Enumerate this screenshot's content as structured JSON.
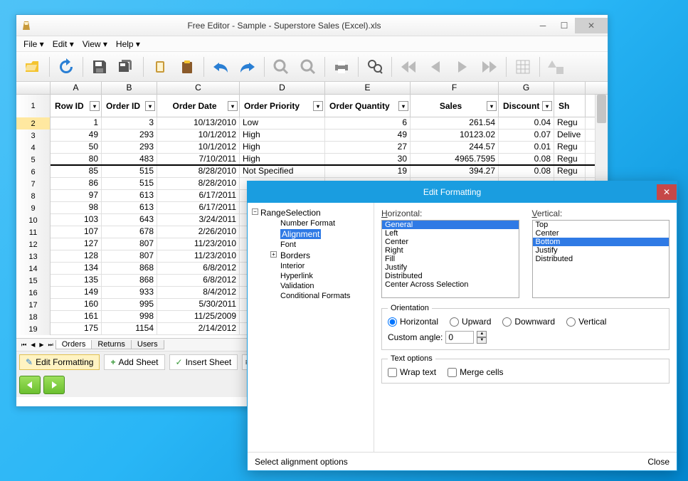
{
  "window": {
    "title": "Free Editor - Sample - Superstore Sales (Excel).xls"
  },
  "menu": {
    "file": "File",
    "edit": "Edit",
    "view": "View",
    "help": "Help"
  },
  "columns_letters": [
    "A",
    "B",
    "C",
    "D",
    "E",
    "F",
    "G"
  ],
  "headers": [
    "Row ID",
    "Order ID",
    "Order Date",
    "Order Priority",
    "Order Quantity",
    "Sales",
    "Discount",
    "Sh"
  ],
  "rows": [
    {
      "n": "2",
      "rid": "1",
      "oid": "3",
      "date": "10/13/2010",
      "prio": "Low",
      "qty": "6",
      "sales": "261.54",
      "disc": "0.04",
      "sh": "Regu"
    },
    {
      "n": "3",
      "rid": "49",
      "oid": "293",
      "date": "10/1/2012",
      "prio": "High",
      "qty": "49",
      "sales": "10123.02",
      "disc": "0.07",
      "sh": "Delive"
    },
    {
      "n": "4",
      "rid": "50",
      "oid": "293",
      "date": "10/1/2012",
      "prio": "High",
      "qty": "27",
      "sales": "244.57",
      "disc": "0.01",
      "sh": "Regu"
    },
    {
      "n": "5",
      "rid": "80",
      "oid": "483",
      "date": "7/10/2011",
      "prio": "High",
      "qty": "30",
      "sales": "4965.7595",
      "disc": "0.08",
      "sh": "Regu"
    },
    {
      "n": "6",
      "rid": "85",
      "oid": "515",
      "date": "8/28/2010",
      "prio": "Not Specified",
      "qty": "19",
      "sales": "394.27",
      "disc": "0.08",
      "sh": "Regu"
    },
    {
      "n": "7",
      "rid": "86",
      "oid": "515",
      "date": "8/28/2010",
      "prio": "",
      "qty": "",
      "sales": "",
      "disc": "",
      "sh": ""
    },
    {
      "n": "8",
      "rid": "97",
      "oid": "613",
      "date": "6/17/2011",
      "prio": "",
      "qty": "",
      "sales": "",
      "disc": "",
      "sh": ""
    },
    {
      "n": "9",
      "rid": "98",
      "oid": "613",
      "date": "6/17/2011",
      "prio": "",
      "qty": "",
      "sales": "",
      "disc": "",
      "sh": ""
    },
    {
      "n": "10",
      "rid": "103",
      "oid": "643",
      "date": "3/24/2011",
      "prio": "",
      "qty": "",
      "sales": "",
      "disc": "",
      "sh": ""
    },
    {
      "n": "11",
      "rid": "107",
      "oid": "678",
      "date": "2/26/2010",
      "prio": "",
      "qty": "",
      "sales": "",
      "disc": "",
      "sh": ""
    },
    {
      "n": "12",
      "rid": "127",
      "oid": "807",
      "date": "11/23/2010",
      "prio": "",
      "qty": "",
      "sales": "",
      "disc": "",
      "sh": ""
    },
    {
      "n": "13",
      "rid": "128",
      "oid": "807",
      "date": "11/23/2010",
      "prio": "",
      "qty": "",
      "sales": "",
      "disc": "",
      "sh": ""
    },
    {
      "n": "14",
      "rid": "134",
      "oid": "868",
      "date": "6/8/2012",
      "prio": "",
      "qty": "",
      "sales": "",
      "disc": "",
      "sh": ""
    },
    {
      "n": "15",
      "rid": "135",
      "oid": "868",
      "date": "6/8/2012",
      "prio": "",
      "qty": "",
      "sales": "",
      "disc": "",
      "sh": ""
    },
    {
      "n": "16",
      "rid": "149",
      "oid": "933",
      "date": "8/4/2012",
      "prio": "",
      "qty": "",
      "sales": "",
      "disc": "",
      "sh": ""
    },
    {
      "n": "17",
      "rid": "160",
      "oid": "995",
      "date": "5/30/2011",
      "prio": "",
      "qty": "",
      "sales": "",
      "disc": "",
      "sh": ""
    },
    {
      "n": "18",
      "rid": "161",
      "oid": "998",
      "date": "11/25/2009",
      "prio": "",
      "qty": "",
      "sales": "",
      "disc": "",
      "sh": ""
    },
    {
      "n": "19",
      "rid": "175",
      "oid": "1154",
      "date": "2/14/2012",
      "prio": "",
      "qty": "",
      "sales": "",
      "disc": "",
      "sh": ""
    }
  ],
  "sheets": [
    "Orders",
    "Returns",
    "Users"
  ],
  "status": {
    "edit_formatting": "Edit Formatting",
    "add_sheet": "Add Sheet",
    "insert_sheet": "Insert Sheet"
  },
  "dialog": {
    "title": "Edit Formatting",
    "tree_root": "RangeSelection",
    "tree_items": [
      "Number Format",
      "Alignment",
      "Font",
      "Borders",
      "Interior",
      "Hyperlink",
      "Validation",
      "Conditional Formats"
    ],
    "h_label": "Horizontal:",
    "v_label": "Vertical:",
    "h_options": [
      "General",
      "Left",
      "Center",
      "Right",
      "Fill",
      "Justify",
      "Distributed",
      "Center Across Selection"
    ],
    "v_options": [
      "Top",
      "Center",
      "Bottom",
      "Justify",
      "Distributed"
    ],
    "orientation": "Orientation",
    "or_horizontal": "Horizontal",
    "or_upward": "Upward",
    "or_downward": "Downward",
    "or_vertical": "Vertical",
    "custom_angle": "Custom angle:",
    "custom_angle_val": "0",
    "text_options": "Text options",
    "wrap": "Wrap text",
    "merge": "Merge cells",
    "status_text": "Select alignment options",
    "close": "Close"
  }
}
